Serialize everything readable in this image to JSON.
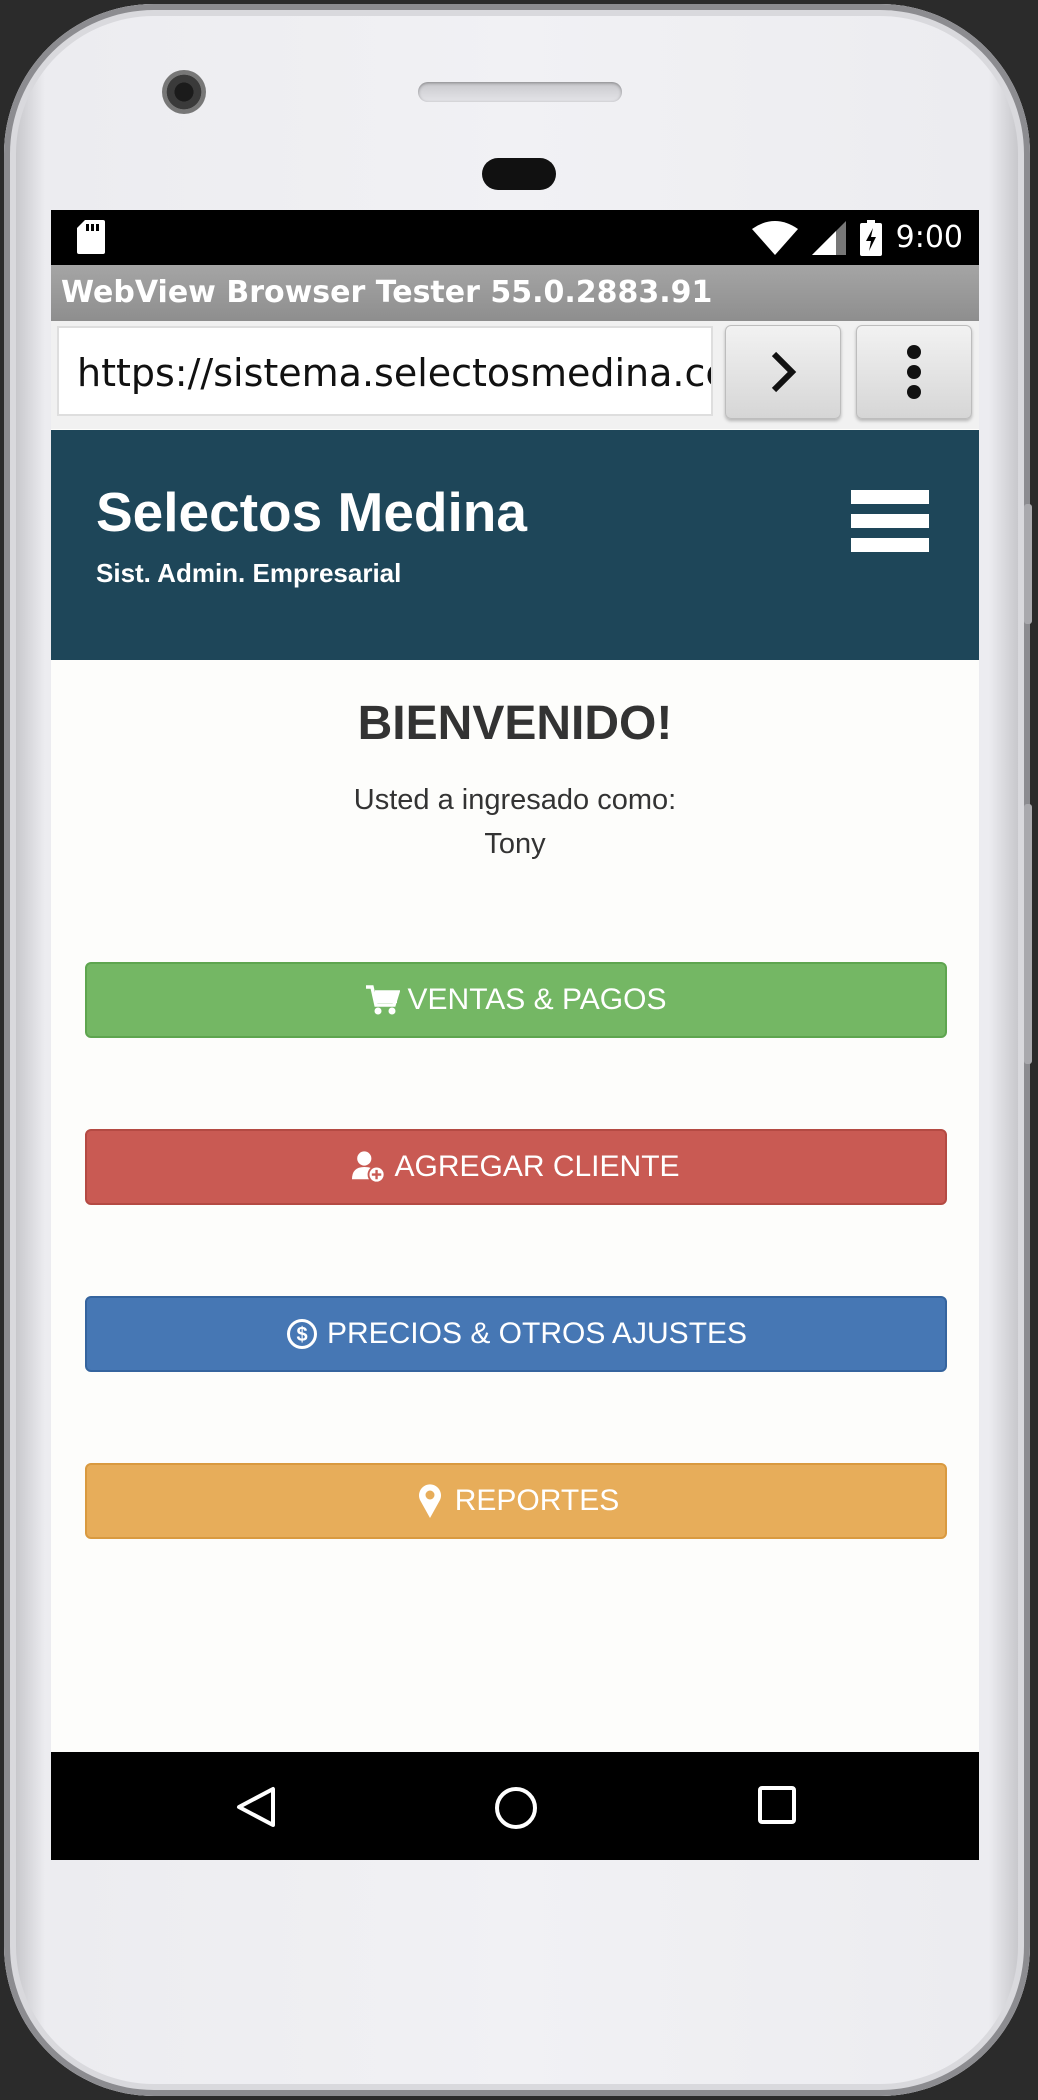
{
  "status_bar": {
    "time": "9:00"
  },
  "app": {
    "title": "WebView Browser Tester 55.0.2883.91"
  },
  "browser": {
    "url": "https://sistema.selectosmedina.cc"
  },
  "site": {
    "brand": "Selectos Medina",
    "subtitle": "Sist. Admin. Empresarial"
  },
  "main": {
    "welcome": "BIENVENIDO!",
    "login_text": "Usted a ingresado como:",
    "user_name": "Tony"
  },
  "buttons": {
    "sales": "VENTAS & PAGOS",
    "add_client": "AGREGAR CLIENTE",
    "prices": "PRECIOS & OTROS AJUSTES",
    "reports": "REPORTES"
  },
  "colors": {
    "header": "#1e4659",
    "sales": "#74b764",
    "add_client": "#c95a53",
    "prices": "#4677b4",
    "reports": "#e7ad5a"
  },
  "icons": {
    "sales": "cart-icon",
    "add_client": "user-plus-icon",
    "prices": "dollar-circle-icon",
    "reports": "map-marker-icon"
  }
}
